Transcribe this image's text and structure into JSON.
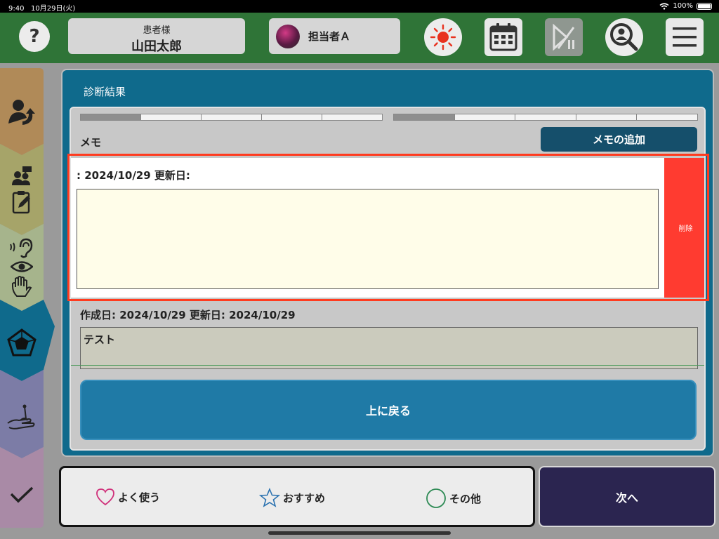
{
  "status": {
    "time": "9:40",
    "date": "10月29日(火)",
    "battery": "100%"
  },
  "header": {
    "help_label": "?",
    "patient_label": "患者様",
    "patient_name": "山田太郎",
    "staff_name": "担当者Ａ",
    "icons": [
      "help-icon",
      "sun-icon",
      "calendar-icon",
      "play-pause-icon",
      "user-search-icon",
      "menu-icon"
    ]
  },
  "sidebar": {
    "tabs": [
      {
        "name": "handover",
        "color": "#b08a58",
        "icons": [
          "person-arrow-icon"
        ]
      },
      {
        "name": "interview",
        "color": "#a6a469",
        "icons": [
          "people-chat-icon",
          "clipboard-edit-icon"
        ]
      },
      {
        "name": "senses",
        "color": "#a6b48c",
        "icons": [
          "ear-icon",
          "eye-icon",
          "hand-icon"
        ]
      },
      {
        "name": "diagnosis",
        "color": "#0f6a8c",
        "icons": [
          "pentagon-chart-icon"
        ]
      },
      {
        "name": "treatment",
        "color": "#7c7ca6",
        "icons": [
          "acupuncture-hand-icon"
        ]
      },
      {
        "name": "done",
        "color": "#a98aa6",
        "icons": [
          "check-icon"
        ]
      }
    ]
  },
  "main": {
    "title": "診断結果",
    "memo_label": "メモ",
    "add_memo_label": "メモの追加",
    "memos": [
      {
        "dates": ":  2024/10/29   更新日:",
        "text": "",
        "delete_label": "削除"
      },
      {
        "dates": "作成日:  2024/10/29   更新日:  2024/10/29",
        "text": "テスト"
      }
    ],
    "back_label": "上に戻る"
  },
  "bottom": {
    "favorites_label": "よく使う",
    "recommended_label": "おすすめ",
    "other_label": "その他",
    "next_label": "次へ"
  },
  "colors": {
    "header_green": "#2f7437",
    "panel_blue": "#0f6a8c",
    "delete_red": "#ff3b30",
    "next_navy": "#2b2550"
  }
}
